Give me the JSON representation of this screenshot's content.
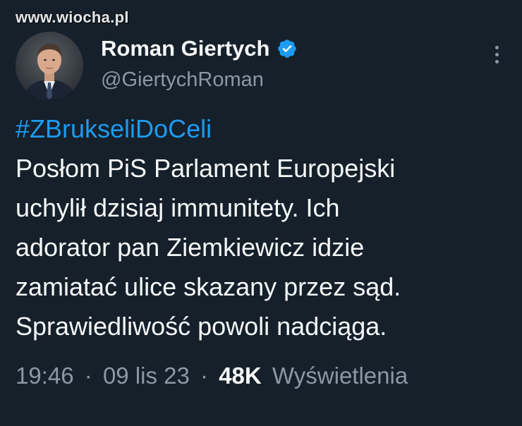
{
  "watermark": {
    "text": "www.wiocha.pl"
  },
  "author": {
    "display_name": "Roman Giertych",
    "handle": "@GiertychRoman",
    "verified": true,
    "avatar_icon": "profile-photo"
  },
  "tweet": {
    "hashtag": "#ZBrukseliDoCeli",
    "lines": [
      "Posłom PiS Parlament Europejski",
      "uchylił dzisiaj immunitety. Ich",
      "adorator pan Ziemkiewicz idzie",
      "zamiatać ulice skazany przez sąd.",
      "Sprawiedliwość powoli nadciąga."
    ]
  },
  "meta": {
    "time": "19:46",
    "separator": "·",
    "date": "09 lis 23",
    "views_count": "48K",
    "views_label": "Wyświetlenia"
  },
  "colors": {
    "background": "#15202b",
    "primary_text": "#f7f9f9",
    "secondary_text": "#8b98a5",
    "accent": "#1d9bf0"
  },
  "icons": {
    "verified": "verified-badge-icon",
    "more": "more-options-icon"
  }
}
